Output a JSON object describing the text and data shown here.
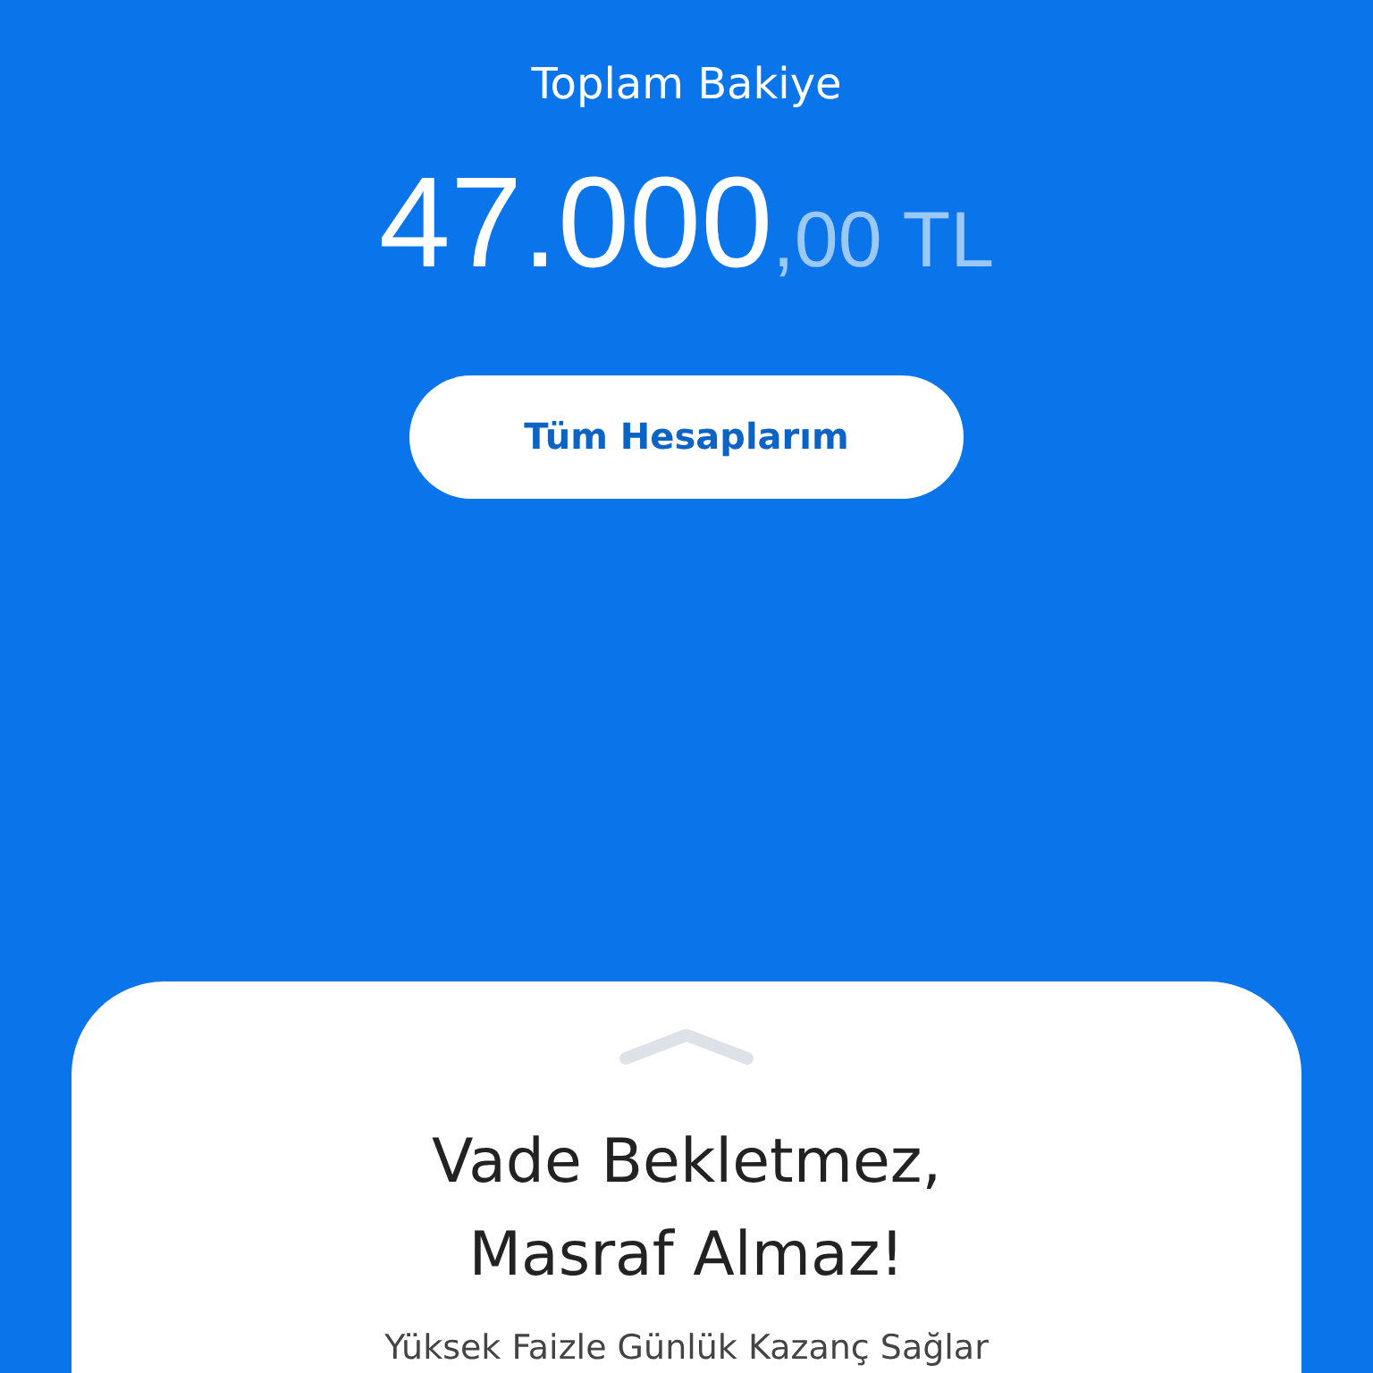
{
  "balance": {
    "label": "Toplam Bakiye",
    "amount_main": "47.000",
    "amount_fraction": ",00 TL"
  },
  "accounts_button": {
    "label": "Tüm Hesaplarım"
  },
  "promo_card": {
    "headline_lines": [
      "Vade Bekletmez,",
      "Masraf Almaz!"
    ],
    "description": "Yüksek Faizle Günlük Kazanç Sağlar"
  }
}
